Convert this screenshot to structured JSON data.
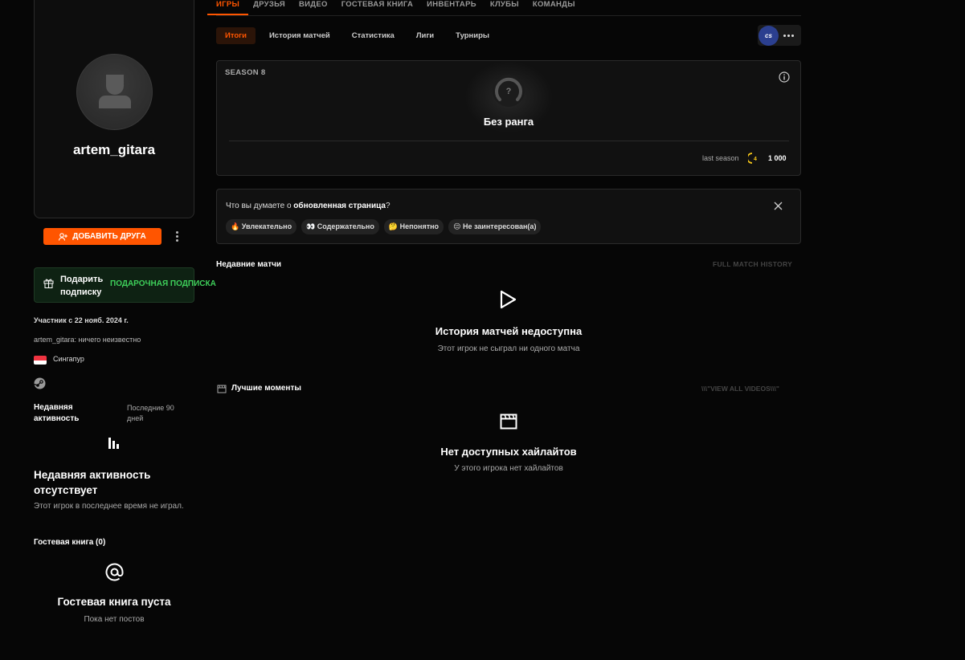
{
  "profile": {
    "username": "artem_gitara",
    "add_friend_label": "ДОБАВИТЬ ДРУГА",
    "gift_label": "Подарить подписку",
    "gift_cta": "ПОДАРОЧНАЯ ПОДПИСКА",
    "member_since": "Участник с 22 нояб. 2024 г.",
    "status": "artem_gitara: ничего неизвестно",
    "country": "Сингапур"
  },
  "activity": {
    "title": "Недавняя активность",
    "period": "Последние 90 дней",
    "empty_title": "Недавняя активность отсутствует",
    "empty_sub": "Этот игрок в последнее время не играл."
  },
  "guestbook": {
    "title": "Гостевая книга (0)",
    "empty_title": "Гостевая книга пуста",
    "empty_sub": "Пока нет постов"
  },
  "topnav": [
    "ИГРЫ",
    "ДРУЗЬЯ",
    "ВИДЕО",
    "ГОСТЕВАЯ КНИГА",
    "ИНВЕНТАРЬ",
    "КЛУБЫ",
    "КОМАНДЫ"
  ],
  "subnav": [
    "Итоги",
    "История матчей",
    "Статистика",
    "Лиги",
    "Турниры"
  ],
  "game_badge": "cs",
  "season": {
    "label": "SEASON 8",
    "rank_name": "Без ранга",
    "rank_symbol": "?",
    "last_season_label": "last season",
    "level": "4",
    "elo": "1 000"
  },
  "feedback": {
    "question_prefix": "Что вы думаете о ",
    "question_bold": "обновленная страница",
    "question_suffix": "?",
    "chips": [
      "🔥 Увлекательно",
      "👀 Содержательно",
      "🤔 Непонятно",
      "😔 Не заинтересован(а)"
    ]
  },
  "matches": {
    "title": "Недавние матчи",
    "full_history": "FULL MATCH HISTORY",
    "empty_title": "История матчей недоступна",
    "empty_sub": "Этот игрок не сыграл ни одного матча"
  },
  "highlights": {
    "title": "Лучшие моменты",
    "view_all": "\\\\\\\"VIEW ALL VIDEOS\\\\\\\"",
    "empty_title": "Нет доступных хайлайтов",
    "empty_sub": "У этого игрока нет хайлайтов"
  },
  "colors": {
    "accent": "#ff5500",
    "gift_green": "#3ecf5a",
    "badge_blue": "#2b3f8f",
    "level_yellow": "#f5c518"
  }
}
